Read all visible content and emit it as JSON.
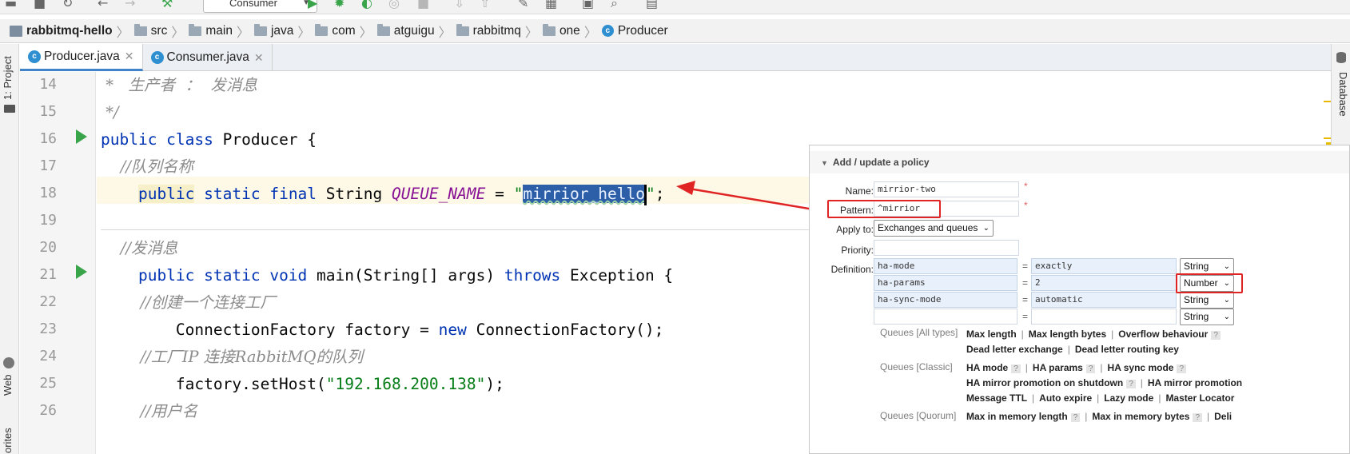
{
  "toolbar": {
    "run_config": "Consumer"
  },
  "breadcrumb": {
    "project": "rabbitmq-hello",
    "folders": [
      "src",
      "main",
      "java",
      "com",
      "atguigu",
      "rabbitmq",
      "one"
    ],
    "file": "Producer"
  },
  "side": {
    "project_label": "1: Project",
    "web_label": "Web",
    "favorites_label": "orites",
    "database_label": "Database"
  },
  "tabs": [
    {
      "label": "Producer.java",
      "active": true
    },
    {
      "label": "Consumer.java",
      "active": false
    }
  ],
  "editor": {
    "line_numbers": [
      "14",
      "15",
      "16",
      "17",
      "18",
      "19",
      "20",
      "21",
      "22",
      "23",
      "24",
      "25",
      "26"
    ],
    "l14": " *   生产者  ：  发消息",
    "l15": " */",
    "l16_kw": "public class",
    "l16_rest": " Producer {",
    "l17": "    //队列名称",
    "l18_kw": "public",
    "l18_kw2": " static final",
    "l18_type": " String ",
    "l18_field": "QUEUE_NAME",
    "l18_eq": " = ",
    "l18_q1": "\"",
    "l18_sel": "mirrior_hello",
    "l18_q2": "\"",
    "l18_end": ";",
    "l20": "    //发消息",
    "l21_kw": "public static void",
    "l21_mid": " main(String[] args) ",
    "l21_kw2": "throws",
    "l21_end": " Exception {",
    "l22": "        //创建一个连接工厂",
    "l23_a": "        ConnectionFactory factory = ",
    "l23_kw": "new",
    "l23_b": " ConnectionFactory();",
    "l24": "        //工厂IP 连接RabbitMQ的队列",
    "l25_a": "        factory.setHost(",
    "l25_str": "\"192.168.200.138\"",
    "l25_b": ");",
    "l26": "        //用户名"
  },
  "policy": {
    "header": "Add / update a policy",
    "name_label": "Name:",
    "name_value": "mirrior-two",
    "pattern_label": "Pattern:",
    "pattern_value": "^mirrior",
    "apply_label": "Apply to:",
    "apply_value": "Exchanges and queues",
    "priority_label": "Priority:",
    "priority_value": "",
    "definition_label": "Definition:",
    "required_mark": "*",
    "eq": "=",
    "definitions": [
      {
        "key": "ha-mode",
        "value": "exactly",
        "type": "String"
      },
      {
        "key": "ha-params",
        "value": "2",
        "type": "Number"
      },
      {
        "key": "ha-sync-mode",
        "value": "automatic",
        "type": "String"
      },
      {
        "key": "",
        "value": "",
        "type": "String"
      }
    ],
    "queues_all_label": "Queues [All types]",
    "queues_all_row1": [
      "Max length",
      "Max length bytes",
      "Overflow behaviour"
    ],
    "queues_all_row2": [
      "Dead letter exchange",
      "Dead letter routing key"
    ],
    "queues_classic_label": "Queues [Classic]",
    "queues_classic_row1": [
      "HA mode",
      "HA params",
      "HA sync mode"
    ],
    "queues_classic_row2": [
      "HA mirror promotion on shutdown",
      "HA mirror promotion"
    ],
    "queues_classic_row3": [
      "Message TTL",
      "Auto expire",
      "Lazy mode",
      "Master Locator"
    ],
    "queues_quorum_label": "Queues [Quorum]",
    "queues_quorum_row1": [
      "Max in memory length",
      "Max in memory bytes",
      "Deli"
    ],
    "help_mark": "?",
    "link_sep": "|"
  },
  "colors": {
    "accent_tab": "#4083c9",
    "annotation_red": "#e02424",
    "keyword": "#0033b3",
    "string": "#067d17",
    "selection": "#2d5fa8"
  }
}
